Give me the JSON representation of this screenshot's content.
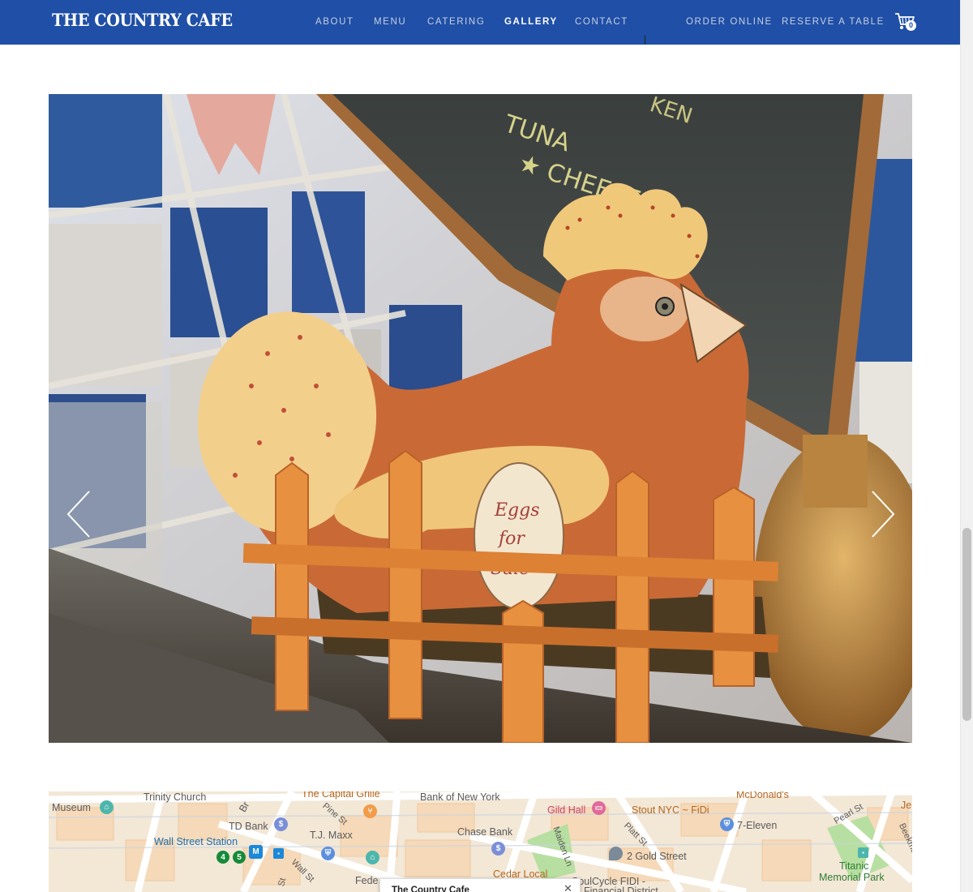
{
  "header": {
    "logo": "THE COUNTRY CAFE",
    "nav": [
      {
        "label": "ABOUT"
      },
      {
        "label": "MENU"
      },
      {
        "label": "CATERING"
      },
      {
        "label": "GALLERY",
        "active": true
      },
      {
        "label": "CONTACT"
      }
    ],
    "order_online": "ORDER ONLINE",
    "reserve_table": "RESERVE A TABLE",
    "cart_count": "0"
  },
  "gallery": {
    "sign_text": [
      "TUNA",
      "★ CHEESE",
      "KEN"
    ],
    "egg_text": [
      "Eggs",
      "for",
      "Sale"
    ]
  },
  "map": {
    "labels": {
      "museum": "Museum",
      "trinity_church": "Trinity Church",
      "capital_grille": "The Capital Grille",
      "bank_of_new_york": "Bank of New York",
      "mcdonalds": "McDonald's",
      "je": "Je",
      "td_bank": "TD Bank",
      "pine_st": "Pine St",
      "tj_maxx": "T.J. Maxx",
      "chase_bank": "Chase Bank",
      "gild_hall": "Gild Hall",
      "stout": "Stout NYC ~ FiDi",
      "platt_st": "Platt St",
      "maiden_ln": "Maiden Ln",
      "seven_eleven": "7-Eleven",
      "pearl_st": "Pearl St",
      "beekman": "Beekman",
      "wall_street_station": "Wall Street Station",
      "wall_st": "Wall St",
      "two_gold_street": "2 Gold Street",
      "titanic": "Titanic",
      "memorial_park": "Memorial Park",
      "cedar_local": "Cedar Local",
      "soulcycle": "SoulCycle FIDI -",
      "financial_district": "Financial District",
      "fede": "Fede",
      "br": "Br",
      "st": "St"
    },
    "subway_lines": [
      "4",
      "5"
    ],
    "subway_badge": "M",
    "infowindow_title": "The Country Cafe",
    "infowindow_close": "✕"
  }
}
